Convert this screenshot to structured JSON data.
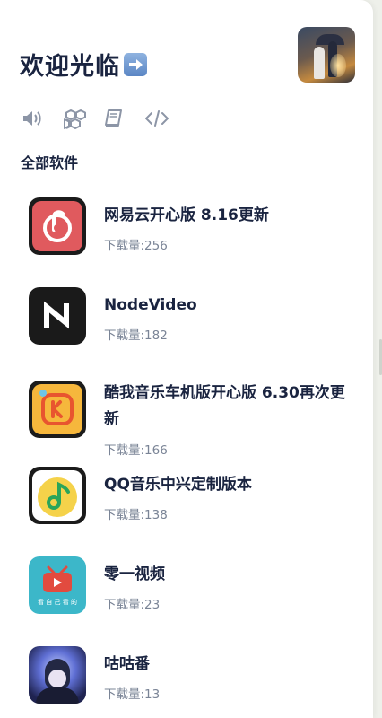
{
  "header": {
    "welcome": "欢迎光临",
    "arrow_icon": "right-arrow-emoji-icon"
  },
  "toolbar": {
    "icons": [
      "speaker-icon",
      "cubes-icon",
      "book-icon",
      "code-icon"
    ]
  },
  "section": {
    "title": "全部软件"
  },
  "apps": [
    {
      "name": "网易云开心版 8.16更新",
      "downloads": "下载量:256",
      "icon": "netease-music-icon"
    },
    {
      "name": "NodeVideo",
      "downloads": "下载量:182",
      "icon": "nodevideo-icon"
    },
    {
      "name": "酷我音乐车机版开心版 6.30再次更新",
      "downloads": "下载量:166",
      "icon": "kuwo-music-icon"
    },
    {
      "name": "QQ音乐中兴定制版本",
      "downloads": "下载量:138",
      "icon": "qq-music-icon"
    },
    {
      "name": "零一视频",
      "downloads": "下载量:23",
      "icon": "video-tv-icon",
      "icon_caption": "看 自 己 看 的"
    },
    {
      "name": "咕咕番",
      "downloads": "下载量:13",
      "icon": "gugufan-anime-icon"
    }
  ],
  "colors": {
    "title": "#1a2440",
    "muted": "#7a8496",
    "netease": "#e05a5e",
    "kuwo": "#f6b73c",
    "qq": "#f5d24a",
    "video": "#3cb7c9"
  }
}
